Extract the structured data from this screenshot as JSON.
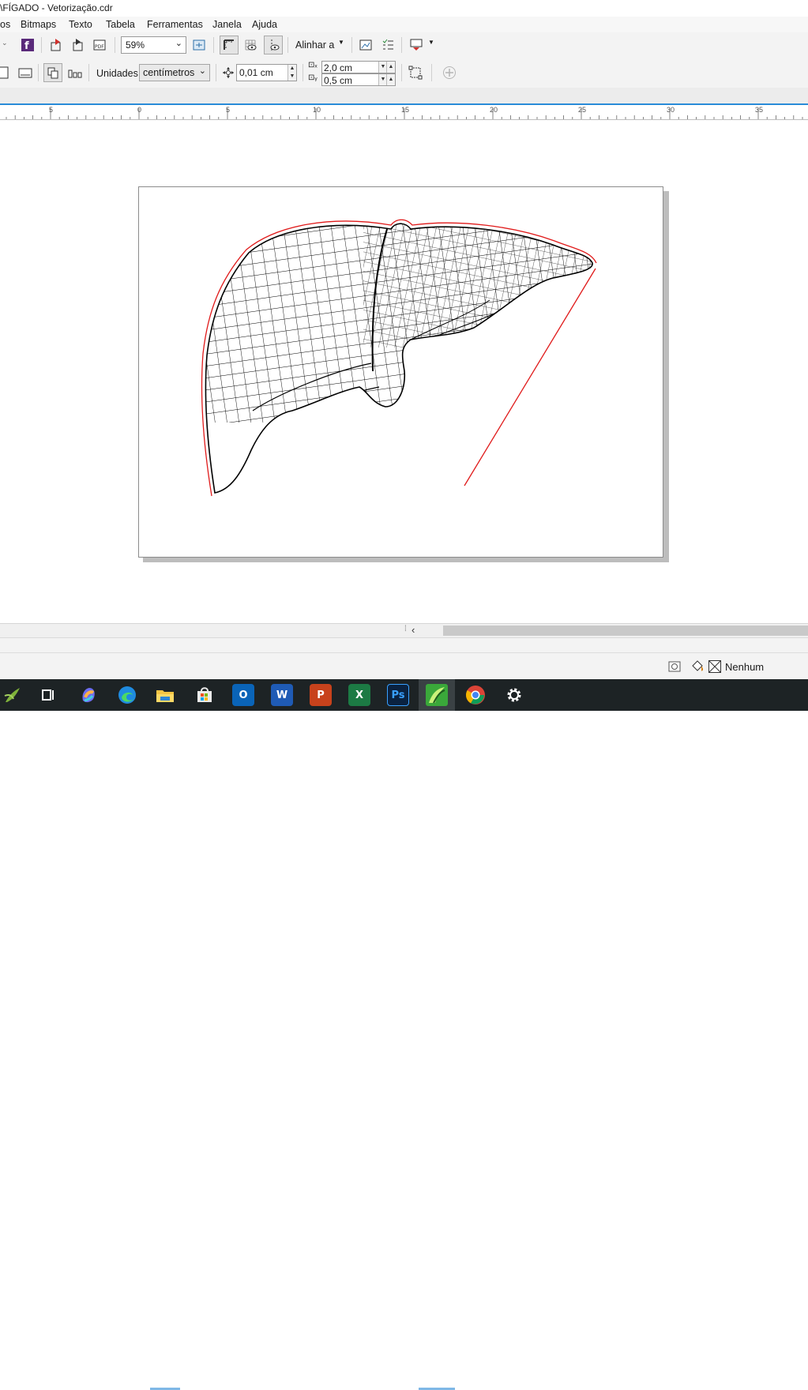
{
  "window": {
    "title": "\\FÍGADO - Vetorização.cdr"
  },
  "menu": {
    "items": [
      {
        "label": "os"
      },
      {
        "label": "Bitmaps"
      },
      {
        "label": "Texto"
      },
      {
        "label": "Tabela"
      },
      {
        "label": "Ferramentas"
      },
      {
        "label": "Janela"
      },
      {
        "label": "Ajuda"
      }
    ]
  },
  "toolbar": {
    "zoom_value": "59%",
    "align_label": "Alinhar a",
    "units_label": "Unidades:",
    "units_value": "centímetros",
    "nudge_value": "0,01 cm",
    "dup_x_value": "2,0 cm",
    "dup_y_value": "0,5 cm"
  },
  "ruler": {
    "labels": [
      "5",
      "0",
      "5",
      "10",
      "15",
      "20",
      "25",
      "30",
      "35"
    ]
  },
  "status": {
    "fill_label": "Nenhum"
  },
  "colors": {
    "outline_red": "#e01a1a",
    "accent_blue": "#2a8bd8",
    "taskbar_bg": "#1d2325"
  },
  "taskbar": {
    "icons": [
      "start-icon",
      "task-view-icon",
      "copilot-icon",
      "edge-icon",
      "file-explorer-icon",
      "store-icon",
      "outlook-icon",
      "word-icon",
      "powerpoint-icon",
      "excel-icon",
      "photoshop-icon",
      "coreldraw-icon",
      "chrome-icon",
      "settings-icon"
    ]
  }
}
